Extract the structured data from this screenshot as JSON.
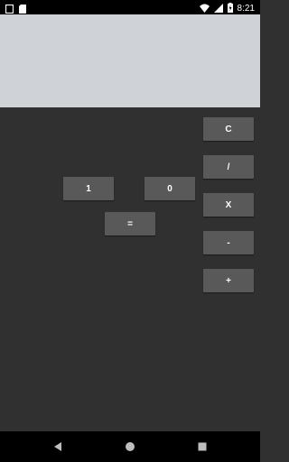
{
  "status_bar": {
    "time": "8:21",
    "icons": [
      "notification-square-icon",
      "sd-card-icon",
      "wifi-icon",
      "signal-icon",
      "battery-charging-icon"
    ]
  },
  "display": {
    "value": ""
  },
  "operators": {
    "clear": "C",
    "divide": "/",
    "multiply": "X",
    "subtract": "-",
    "add": "+"
  },
  "digits": {
    "one": "1",
    "zero": "0"
  },
  "equals_label": "=",
  "nav_bar": {
    "icons": [
      "back-icon",
      "home-icon",
      "recents-icon"
    ]
  },
  "colors": {
    "display_bg": "#cfd3d8",
    "body_bg": "#303030",
    "button_bg": "#595959"
  }
}
